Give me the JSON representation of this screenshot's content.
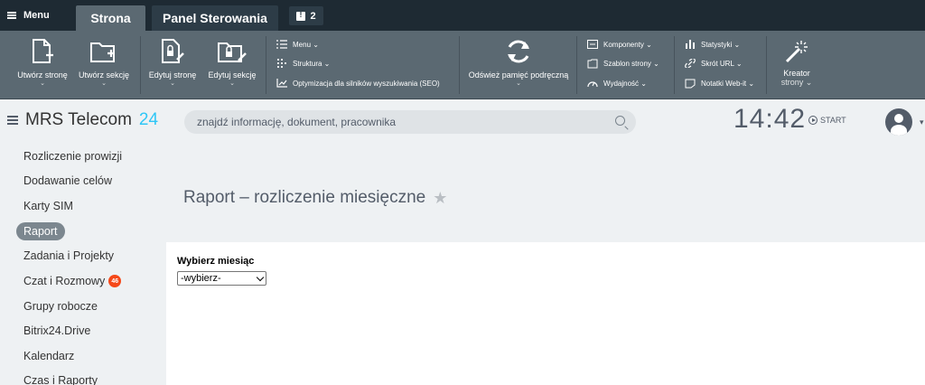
{
  "admin_bar": {
    "menu_label": "Menu",
    "tabs": [
      {
        "label": "Strona"
      },
      {
        "label": "Panel Sterowania"
      }
    ],
    "notifications_count": "2"
  },
  "toolbar": {
    "create_page": {
      "label": "Utwórz stronę",
      "caret": "⌄"
    },
    "create_section": {
      "label": "Utwórz sekcję",
      "caret": "⌄"
    },
    "edit_page": {
      "label": "Edytuj stronę",
      "caret": "⌄"
    },
    "edit_section": {
      "label": "Edytuj sekcję",
      "caret": "⌄"
    },
    "menu": "Menu ⌄",
    "structure": "Struktura ⌄",
    "seo": "Optymizacja dla silników wyszukiwania (SEO)",
    "clear_cache": {
      "label": "Odśwież pamięć podręczną",
      "caret": "⌄"
    },
    "components": "Komponenty ⌄",
    "page_template": "Szablon strony ⌄",
    "performance": "Wydajność ⌄",
    "statistics": "Statystyki ⌄",
    "short_url": "Skrót URL ⌄",
    "notes": "Notatki Web-it ⌄",
    "wizard": {
      "line1": "Kreator",
      "line2": "strony ⌄"
    }
  },
  "header": {
    "logo_text": "MRS Telecom",
    "logo_suffix": "24",
    "search_placeholder": "znajdź informację, dokument, pracownika",
    "clock": "14:42",
    "start_label": "START"
  },
  "sidebar": {
    "items": [
      {
        "label": "Rozliczenie prowizji"
      },
      {
        "label": "Dodawanie celów"
      },
      {
        "label": "Karty SIM"
      },
      {
        "label": "Raport"
      },
      {
        "label": "Zadania i Projekty"
      },
      {
        "label": "Czat i Rozmowy",
        "badge": "46"
      },
      {
        "label": "Grupy robocze"
      },
      {
        "label": "Bitrix24.Drive"
      },
      {
        "label": "Kalendarz"
      },
      {
        "label": "Czas i Raporty"
      }
    ]
  },
  "main": {
    "title": "Raport – rozliczenie miesięczne",
    "month_label": "Wybierz miesiąc",
    "month_select_value": "-wybierz-"
  },
  "colors": {
    "accent": "#2fc6f6",
    "badge": "#f54819",
    "toolbar": "#5b6972",
    "topbar": "#1e2a33"
  }
}
